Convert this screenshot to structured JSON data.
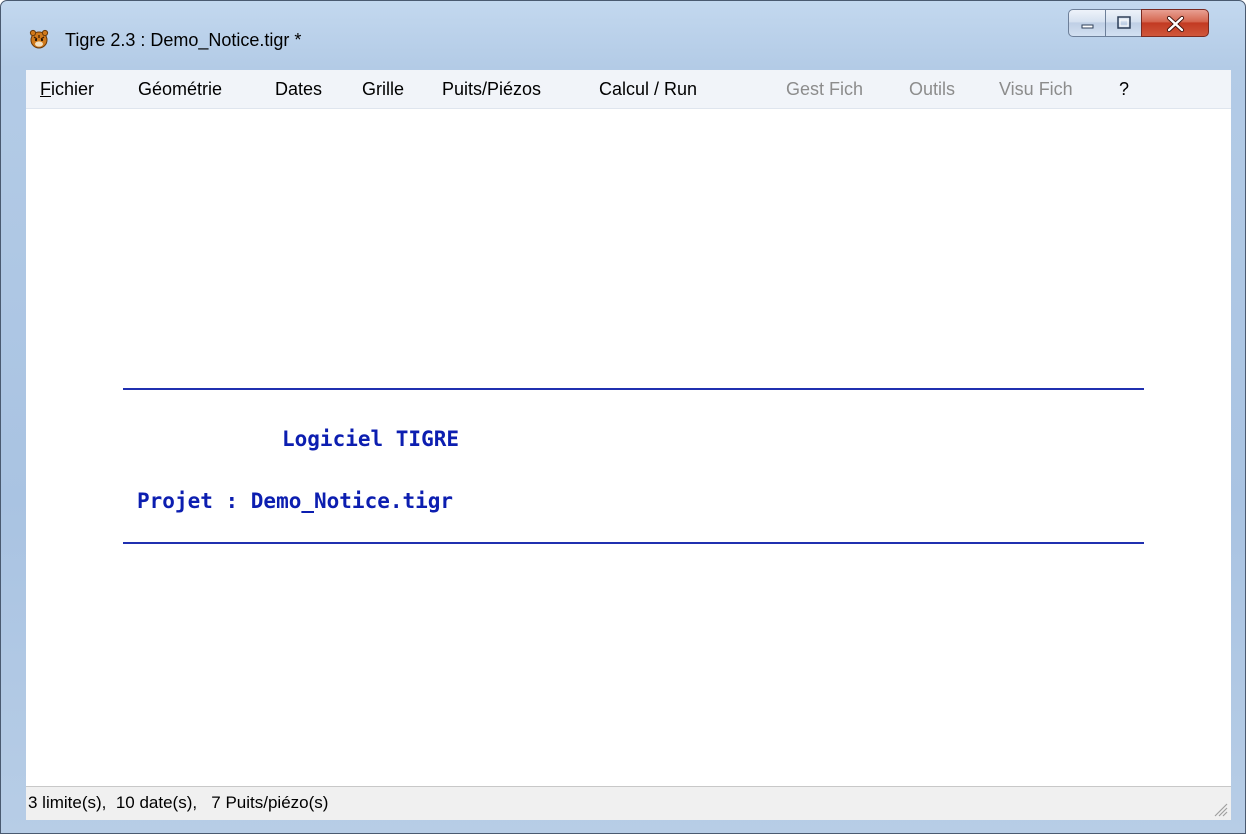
{
  "window": {
    "title": "Tigre 2.3 : Demo_Notice.tigr *",
    "icon": "tiger-head-icon",
    "controls": [
      "minimize-icon",
      "maximize-icon",
      "close-icon"
    ]
  },
  "menu": {
    "items": [
      {
        "label": "Fichier",
        "accel": "F",
        "rest": "ichier",
        "enabled": true
      },
      {
        "label": "Géométrie",
        "enabled": true
      },
      {
        "label": "Dates",
        "enabled": true
      },
      {
        "label": "Grille",
        "enabled": true
      },
      {
        "label": "Puits/Piézos",
        "enabled": true
      },
      {
        "label": "Calcul / Run",
        "enabled": true
      },
      {
        "label": "Gest Fich",
        "enabled": false
      },
      {
        "label": "Outils",
        "enabled": false
      },
      {
        "label": "Visu Fich",
        "enabled": false
      },
      {
        "label": "?",
        "enabled": true
      }
    ]
  },
  "banner": {
    "software_line": "Logiciel TIGRE",
    "project_line": "Projet : Demo_Notice.tigr",
    "color": "#0c1eb0"
  },
  "status": {
    "text": "3 limite(s),  10 date(s),   7 Puits/piézo(s)"
  },
  "colors": {
    "text_blue": "#0c1eb0",
    "rule_blue": "#2030b0",
    "disabled_menu": "#8c8c8c"
  }
}
